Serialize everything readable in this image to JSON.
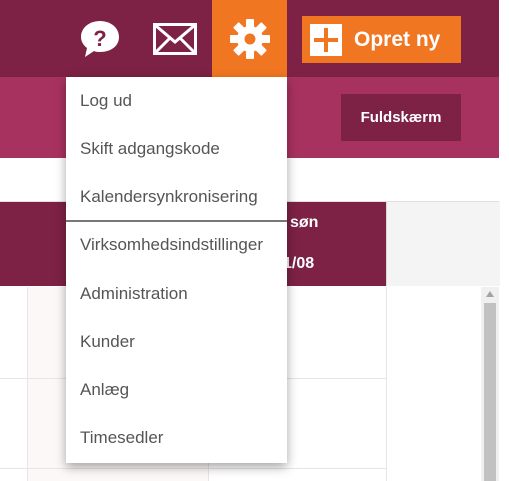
{
  "topbar": {
    "help_icon": "question-bubble-icon",
    "mail_icon": "envelope-icon",
    "settings_icon": "gear-icon",
    "create_label": "Opret ny",
    "colors": {
      "bar": "#7d2244",
      "accent": "#f07622",
      "subbar": "#a8325f"
    }
  },
  "toolbar": {
    "fullscreen_label": "Fuldskærm"
  },
  "calendar": {
    "day_name": "søn",
    "day_date": "1/08"
  },
  "menu": {
    "items": [
      {
        "label": "Log ud"
      },
      {
        "label": "Skift adgangskode"
      },
      {
        "label": "Kalendersynkronisering"
      },
      {
        "label": "Virksomhedsindstillinger"
      },
      {
        "label": "Administration"
      },
      {
        "label": "Kunder"
      },
      {
        "label": "Anlæg"
      },
      {
        "label": "Timesedler"
      }
    ]
  }
}
